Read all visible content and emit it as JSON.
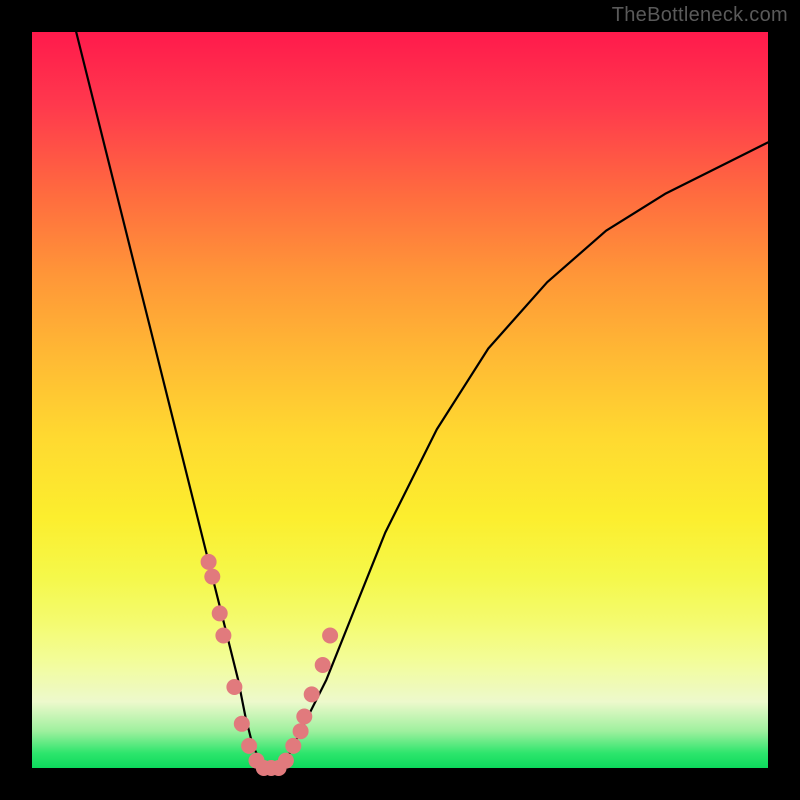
{
  "watermark": "TheBottleneck.com",
  "colors": {
    "background_frame": "#000000",
    "dot": "#e17a7d",
    "curve": "#000000",
    "gradient_top": "#ff1a4c",
    "gradient_bottom": "#0cd95c"
  },
  "chart_data": {
    "type": "line",
    "title": "",
    "xlabel": "",
    "ylabel": "",
    "xlim": [
      0,
      100
    ],
    "ylim": [
      0,
      100
    ],
    "grid": false,
    "series": [
      {
        "name": "bottleneck-curve",
        "x": [
          6,
          8,
          10,
          12,
          14,
          16,
          18,
          20,
          22,
          24,
          26,
          28,
          29,
          30,
          31,
          32,
          33.5,
          35,
          37,
          40,
          44,
          48,
          55,
          62,
          70,
          78,
          86,
          94,
          100
        ],
        "y": [
          100,
          92,
          84,
          76,
          68,
          60,
          52,
          44,
          36,
          28,
          20,
          12,
          7,
          3,
          1,
          0,
          0,
          2,
          6,
          12,
          22,
          32,
          46,
          57,
          66,
          73,
          78,
          82,
          85
        ]
      }
    ],
    "dots": {
      "name": "highlight-dots",
      "x": [
        24.0,
        24.5,
        25.5,
        26.0,
        27.5,
        28.5,
        29.5,
        30.5,
        31.5,
        32.5,
        33.5,
        34.5,
        35.5,
        36.5,
        37.0,
        38.0,
        39.5,
        40.5
      ],
      "y": [
        28,
        26,
        21,
        18,
        11,
        6,
        3,
        1,
        0,
        0,
        0,
        1,
        3,
        5,
        7,
        10,
        14,
        18
      ]
    }
  }
}
